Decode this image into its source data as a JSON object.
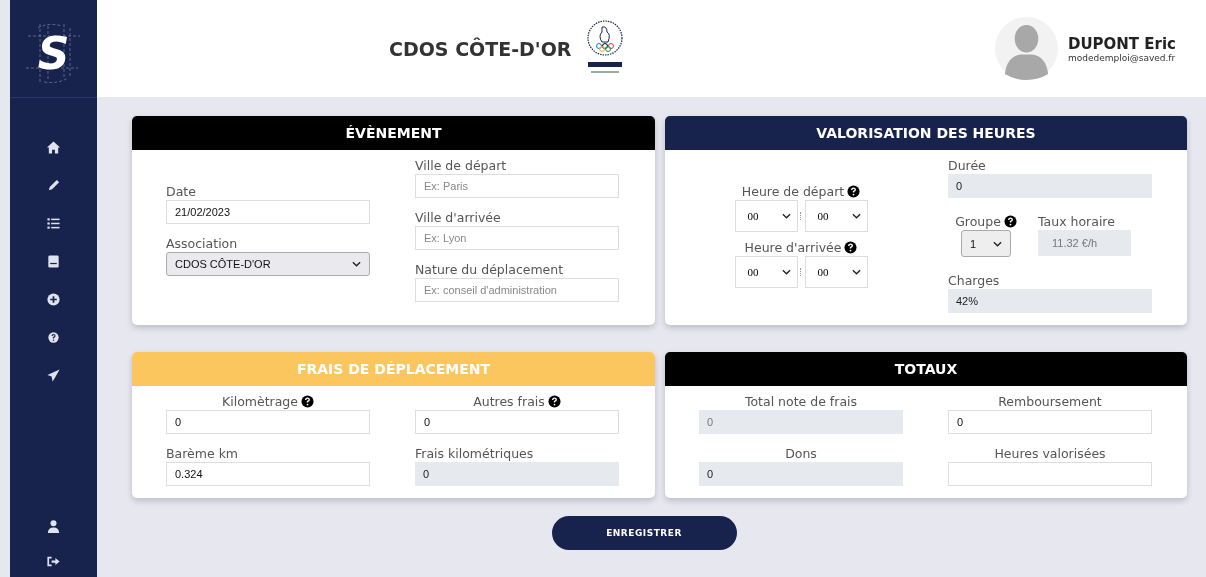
{
  "sidebar": {
    "logo": "S"
  },
  "header": {
    "title": "CDOS CÔTE-D'OR",
    "user_name": "DUPONT Eric",
    "user_email": "modedemploi@saved.fr"
  },
  "cards": [
    {
      "title": "ÉVÈNEMENT",
      "color": "#000000",
      "columns": [
        [
          {
            "kind": "text",
            "label": "Date",
            "help": false,
            "value": "21/02/2023",
            "readonly": false,
            "disabled": false
          },
          {
            "kind": "select",
            "label": "Association",
            "help": false,
            "value": "CDOS CÔTE-D'OR"
          }
        ],
        [
          {
            "kind": "text",
            "label": "Ville de départ",
            "help": false,
            "placeholder": "Ex: Paris",
            "readonly": false
          },
          {
            "kind": "text",
            "label": "Ville d'arrivée",
            "help": false,
            "placeholder": "Ex: Lyon",
            "readonly": false
          },
          {
            "kind": "text",
            "label": "Nature du déplacement",
            "help": false,
            "placeholder": "Ex: conseil d'administration",
            "readonly": false
          }
        ]
      ]
    },
    {
      "title": "VALORISATION DES HEURES",
      "color": "#17224d",
      "columns": [
        [
          {
            "kind": "time",
            "label": "Heure de départ",
            "help": true,
            "hours": "00",
            "minutes": "00"
          },
          {
            "kind": "time",
            "label": "Heure d'arrivée",
            "help": true,
            "hours": "00",
            "minutes": "00"
          }
        ],
        [
          {
            "kind": "text",
            "label": "Durée",
            "help": false,
            "value": "0",
            "readonly": true,
            "disabled": false
          },
          {
            "kind": "pair",
            "fields": [
              {
                "kind": "small-select",
                "label": "Groupe",
                "help": true,
                "value": "1"
              },
              {
                "kind": "text",
                "label": "Taux horaire",
                "help": false,
                "value": "11.32 €/h",
                "readonly": true,
                "disabled": true
              }
            ]
          },
          {
            "kind": "text",
            "label": "Charges",
            "help": false,
            "value": "42%",
            "readonly": true,
            "disabled": false
          }
        ]
      ]
    },
    {
      "title": "FRAIS DE DÉPLACEMENT",
      "color": "#fcc65e",
      "columns": [
        [
          {
            "kind": "text",
            "label": "Kilomètrage",
            "help": true,
            "value": "0",
            "readonly": false,
            "disabled": false
          },
          {
            "kind": "text",
            "label": "Barème km",
            "help": false,
            "value": "0.324",
            "readonly": false,
            "disabled": false
          }
        ],
        [
          {
            "kind": "text",
            "label": "Autres frais",
            "help": true,
            "value": "0",
            "readonly": false,
            "disabled": false
          },
          {
            "kind": "text",
            "label": "Frais kilométriques",
            "help": false,
            "value": "0",
            "readonly": true,
            "disabled": false
          }
        ]
      ]
    },
    {
      "title": "TOTAUX",
      "color": "#000000",
      "columns": [
        [
          {
            "kind": "text",
            "label": "Total note de frais",
            "help": false,
            "value": "0",
            "readonly": true,
            "disabled": true
          },
          {
            "kind": "text",
            "label": "Dons",
            "help": false,
            "value": "0",
            "readonly": true,
            "disabled": false
          }
        ],
        [
          {
            "kind": "text",
            "label": "Remboursement",
            "help": false,
            "value": "0",
            "readonly": false,
            "disabled": false
          },
          {
            "kind": "text",
            "label": "Heures valorisées",
            "help": false,
            "readonly": false
          }
        ]
      ]
    }
  ],
  "save_button": "ENREGISTRER"
}
